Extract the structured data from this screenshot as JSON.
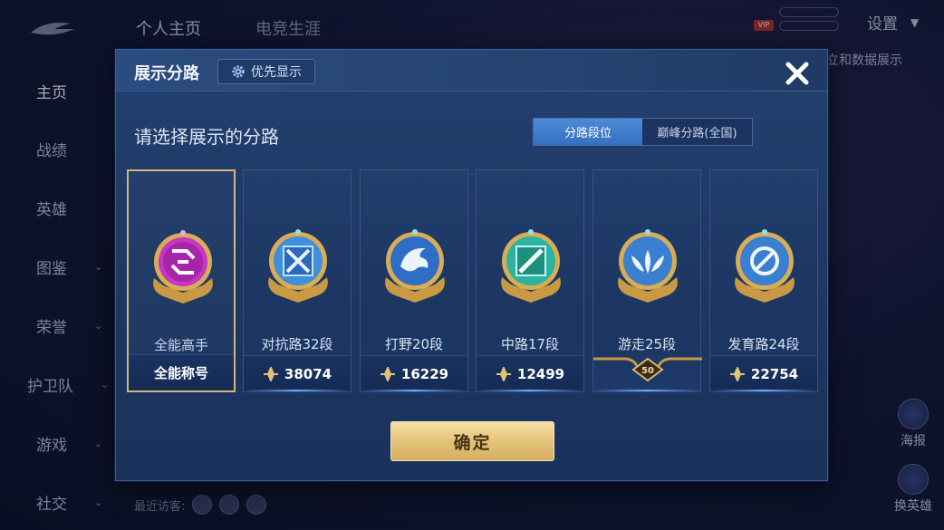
{
  "background": {
    "top_tabs": [
      "个人主页",
      "电竞生涯"
    ],
    "sidenav": [
      {
        "label": "主页",
        "chevron": false
      },
      {
        "label": "战绩",
        "chevron": false
      },
      {
        "label": "英雄",
        "chevron": false
      },
      {
        "label": "图鉴",
        "chevron": true
      },
      {
        "label": "荣誉",
        "chevron": true
      },
      {
        "label": "护卫队",
        "chevron": true
      },
      {
        "label": "游戏",
        "chevron": true
      },
      {
        "label": "社交",
        "chevron": true
      }
    ],
    "vip_label": "VIP",
    "settings_label": "设置",
    "right_partial_label": "立和数据展示",
    "right_buttons": [
      "海报",
      "换英雄"
    ],
    "recent_visitors_label": "最近访客:"
  },
  "modal": {
    "title": "展示分路",
    "priority_button": "优先显示",
    "subtitle": "请选择展示的分路",
    "segments": [
      "分路段位",
      "巅峰分路(全国)"
    ],
    "active_segment": 0,
    "cards": [
      {
        "name": "全能高手",
        "footer": "全能称号",
        "emblem_color": "#c437c0",
        "icon": "all-round-emblem-icon",
        "selected": true
      },
      {
        "name": "对抗路32段",
        "footer": "38074",
        "emblem_color": "#3f8fd9",
        "icon": "clash-lane-emblem-icon",
        "selected": false
      },
      {
        "name": "打野20段",
        "footer": "16229",
        "emblem_color": "#2f6ec6",
        "icon": "jungle-emblem-icon",
        "selected": false
      },
      {
        "name": "中路17段",
        "footer": "12499",
        "emblem_color": "#2bb3a0",
        "icon": "mid-lane-emblem-icon",
        "selected": false
      },
      {
        "name": "游走25段",
        "footer": "50",
        "emblem_color": "#3b7fd0",
        "icon": "roam-emblem-icon",
        "selected": false
      },
      {
        "name": "发育路24段",
        "footer": "22754",
        "emblem_color": "#3b7fd0",
        "icon": "farm-lane-emblem-icon",
        "selected": false
      }
    ],
    "confirm_label": "确定"
  },
  "colors": {
    "accent_blue": "#4d8ad8",
    "gold": "#d6b57a",
    "panel": "#23406f"
  }
}
